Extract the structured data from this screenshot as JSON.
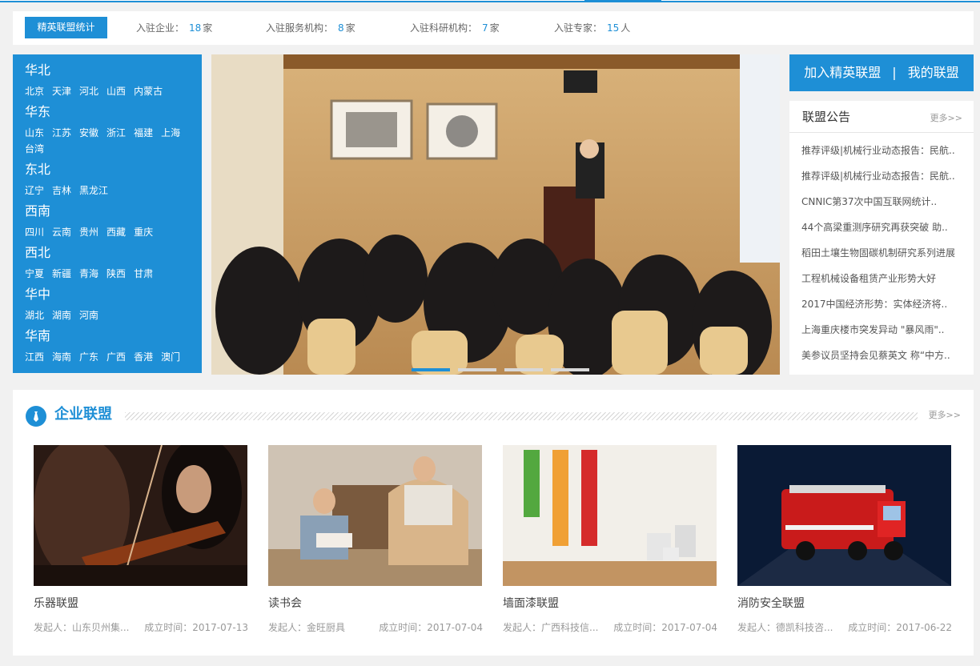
{
  "stats": {
    "badge": "精英联盟统计",
    "items": [
      {
        "label": "入驻企业：",
        "value": "18",
        "unit": "家"
      },
      {
        "label": "入驻服务机构：",
        "value": "8",
        "unit": "家"
      },
      {
        "label": "入驻科研机构：",
        "value": "7",
        "unit": "家"
      },
      {
        "label": "入驻专家：",
        "value": "15",
        "unit": "人"
      }
    ]
  },
  "regions": [
    {
      "name": "华北",
      "cities": [
        "北京",
        "天津",
        "河北",
        "山西",
        "内蒙古"
      ]
    },
    {
      "name": "华东",
      "cities": [
        "山东",
        "江苏",
        "安徽",
        "浙江",
        "福建",
        "上海",
        "台湾"
      ]
    },
    {
      "name": "东北",
      "cities": [
        "辽宁",
        "吉林",
        "黑龙江"
      ]
    },
    {
      "name": "西南",
      "cities": [
        "四川",
        "云南",
        "贵州",
        "西藏",
        "重庆"
      ]
    },
    {
      "name": "西北",
      "cities": [
        "宁夏",
        "新疆",
        "青海",
        "陕西",
        "甘肃"
      ]
    },
    {
      "name": "华中",
      "cities": [
        "湖北",
        "湖南",
        "河南"
      ]
    },
    {
      "name": "华南",
      "cities": [
        "江西",
        "海南",
        "广东",
        "广西",
        "香港",
        "澳门"
      ]
    }
  ],
  "join": {
    "join_label": "加入精英联盟",
    "sep": "|",
    "mine_label": "我的联盟"
  },
  "notice": {
    "title": "联盟公告",
    "more": "更多>>",
    "items": [
      "推荐评级|机械行业动态报告：民航..",
      "推荐评级|机械行业动态报告：民航..",
      "CNNIC第37次中国互联网统计..",
      "44个高梁重测序研究再获突破 助..",
      "稻田土壤生物固碳机制研究系列进展",
      "工程机械设备租赁产业形势大好",
      "2017中国经济形势：实体经济将..",
      "上海重庆楼市突发异动 \"暴风雨\"..",
      "美参议员坚持会见蔡英文 称“中方.."
    ]
  },
  "alliance": {
    "title": "企业联盟",
    "more": "更多>>",
    "cards": [
      {
        "name": "乐器联盟",
        "initiator": "发起人：山东贝州集...",
        "date": "成立时间：2017-07-13"
      },
      {
        "name": "读书会",
        "initiator": "发起人：金旺厨具",
        "date": "成立时间：2017-07-04"
      },
      {
        "name": "墙面漆联盟",
        "initiator": "发起人：广西科技信...",
        "date": "成立时间：2017-07-04"
      },
      {
        "name": "消防安全联盟",
        "initiator": "发起人：德凯科技咨...",
        "date": "成立时间：2017-06-22"
      }
    ]
  }
}
